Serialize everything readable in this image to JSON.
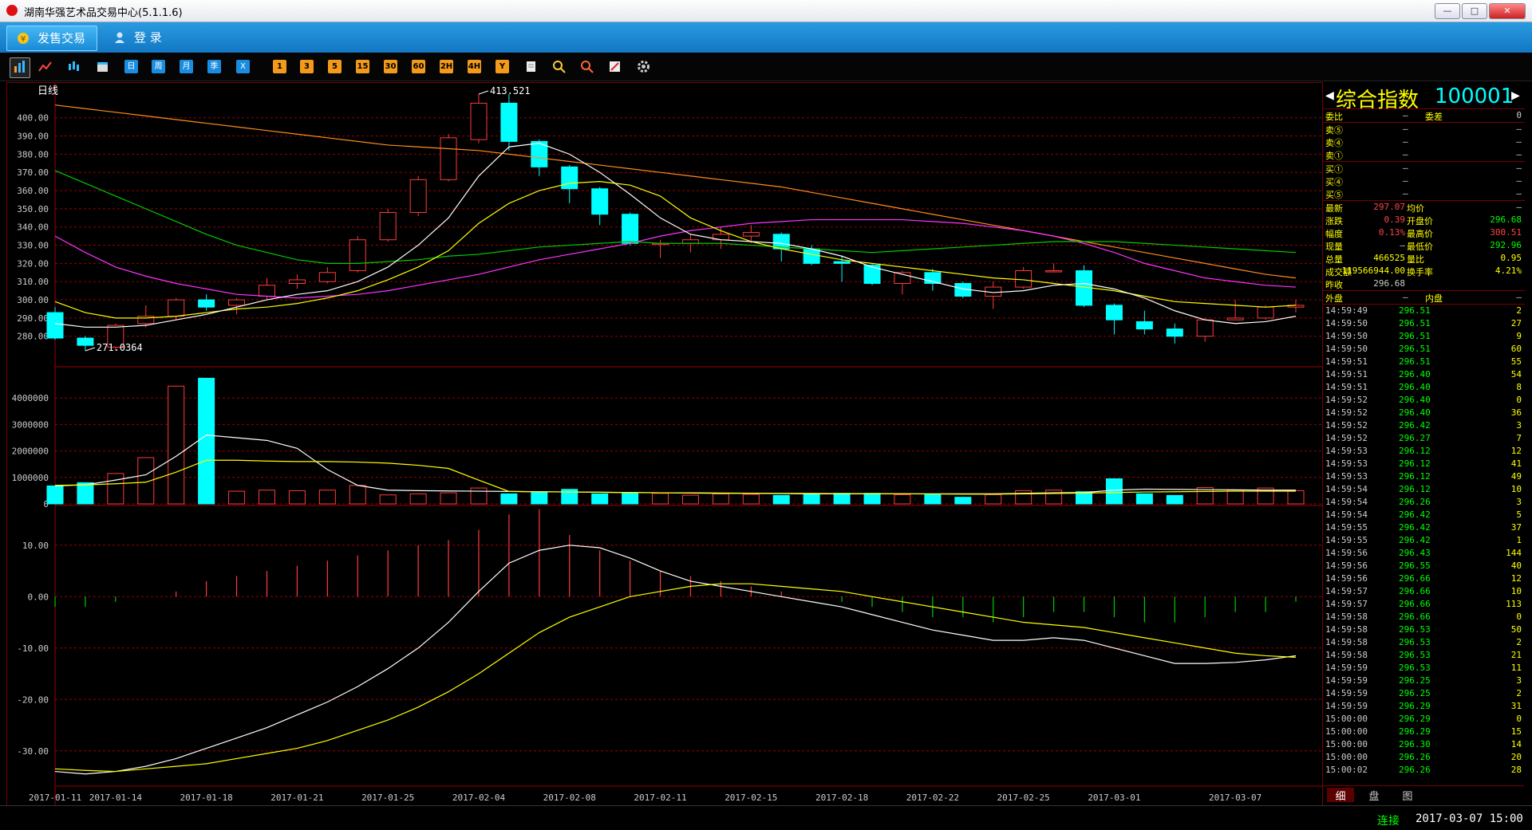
{
  "window": {
    "title": "湖南华强艺术品交易中心(5.1.1.6)",
    "minimize": "—",
    "maximize": "□",
    "close": "✕"
  },
  "menu": {
    "tab_trade": "发售交易",
    "tab_login": "登  录"
  },
  "toolbar": {
    "buttons_a": [
      "日",
      "周",
      "月",
      "季",
      "X"
    ],
    "buttons_b": [
      "1",
      "3",
      "5",
      "15",
      "30",
      "60",
      "2H",
      "4H",
      "Y"
    ]
  },
  "chart_period": "日线",
  "quote": {
    "name": "综合指数",
    "code": "100001",
    "rows1": [
      {
        "l": "委比",
        "v": "—",
        "l2": "委差",
        "v2": "0"
      }
    ],
    "sell": [
      {
        "l": "卖⑤",
        "v": "—",
        "v2": "—"
      },
      {
        "l": "卖④",
        "v": "—",
        "v2": "—"
      },
      {
        "l": "卖①",
        "v": "—",
        "v2": "—"
      }
    ],
    "buy": [
      {
        "l": "买①",
        "v": "—",
        "v2": "—"
      },
      {
        "l": "买④",
        "v": "—",
        "v2": "—"
      },
      {
        "l": "买⑤",
        "v": "—",
        "v2": "—"
      }
    ],
    "stats": [
      {
        "l": "最新",
        "v": "297.07",
        "l2": "均价",
        "v2": "—",
        "c": "#f44",
        "c2": "#ccc"
      },
      {
        "l": "涨跌",
        "v": "0.39",
        "l2": "开盘价",
        "v2": "296.68",
        "c": "#f44",
        "c2": "#0f0"
      },
      {
        "l": "幅度",
        "v": "0.13%",
        "l2": "最高价",
        "v2": "300.51",
        "c": "#f44",
        "c2": "#f44"
      },
      {
        "l": "现量",
        "v": "—",
        "l2": "最低价",
        "v2": "292.96",
        "c": "#ccc",
        "c2": "#0f0"
      },
      {
        "l": "总量",
        "v": "466525",
        "l2": "量比",
        "v2": "0.95",
        "c": "#ff0",
        "c2": "#ff0"
      },
      {
        "l": "成交额",
        "v": "119566944.00",
        "l2": "换手率",
        "v2": "4.21%",
        "c": "#ff0",
        "c2": "#ff0"
      },
      {
        "l": "昨收",
        "v": "296.68",
        "l2": "",
        "v2": "",
        "c": "#ccc",
        "c2": "#ccc"
      }
    ],
    "outer_label": "外盘",
    "outer_val": "—",
    "inner_label": "内盘",
    "inner_val": "—"
  },
  "ticks": [
    [
      "14:59:49",
      "296.51",
      "2"
    ],
    [
      "14:59:50",
      "296.51",
      "27"
    ],
    [
      "14:59:50",
      "296.51",
      "9"
    ],
    [
      "14:59:50",
      "296.51",
      "60"
    ],
    [
      "14:59:51",
      "296.51",
      "55"
    ],
    [
      "14:59:51",
      "296.40",
      "54"
    ],
    [
      "14:59:51",
      "296.40",
      "8"
    ],
    [
      "14:59:52",
      "296.40",
      "0"
    ],
    [
      "14:59:52",
      "296.40",
      "36"
    ],
    [
      "14:59:52",
      "296.42",
      "3"
    ],
    [
      "14:59:52",
      "296.27",
      "7"
    ],
    [
      "14:59:53",
      "296.12",
      "12"
    ],
    [
      "14:59:53",
      "296.12",
      "41"
    ],
    [
      "14:59:53",
      "296.12",
      "49"
    ],
    [
      "14:59:54",
      "296.12",
      "10"
    ],
    [
      "14:59:54",
      "296.26",
      "3"
    ],
    [
      "14:59:54",
      "296.42",
      "5"
    ],
    [
      "14:59:55",
      "296.42",
      "37"
    ],
    [
      "14:59:55",
      "296.42",
      "1"
    ],
    [
      "14:59:56",
      "296.43",
      "144"
    ],
    [
      "14:59:56",
      "296.55",
      "40"
    ],
    [
      "14:59:56",
      "296.66",
      "12"
    ],
    [
      "14:59:57",
      "296.66",
      "10"
    ],
    [
      "14:59:57",
      "296.66",
      "113"
    ],
    [
      "14:59:58",
      "296.66",
      "0"
    ],
    [
      "14:59:58",
      "296.53",
      "50"
    ],
    [
      "14:59:58",
      "296.53",
      "2"
    ],
    [
      "14:59:58",
      "296.53",
      "21"
    ],
    [
      "14:59:59",
      "296.53",
      "11"
    ],
    [
      "14:59:59",
      "296.25",
      "3"
    ],
    [
      "14:59:59",
      "296.25",
      "2"
    ],
    [
      "14:59:59",
      "296.29",
      "31"
    ],
    [
      "15:00:00",
      "296.29",
      "0"
    ],
    [
      "15:00:00",
      "296.29",
      "15"
    ],
    [
      "15:00:00",
      "296.30",
      "14"
    ],
    [
      "15:00:00",
      "296.26",
      "20"
    ],
    [
      "15:00:02",
      "296.26",
      "28"
    ]
  ],
  "bottom_tabs": [
    "细",
    "盘",
    "图"
  ],
  "status": {
    "connection": "连接",
    "datetime": "2017-03-07 15:00"
  },
  "chart_data": {
    "type": "candlestick",
    "price_axis": {
      "ticks": [
        "400.00",
        "390.00",
        "380.00",
        "370.00",
        "360.00",
        "350.00",
        "340.00",
        "330.00",
        "320.00",
        "310.00",
        "300.00",
        "290.00",
        "280.00"
      ],
      "ylim": [
        272,
        413
      ]
    },
    "volume_axis": {
      "ticks": [
        "4000000",
        "3000000",
        "2000000",
        "1000000",
        "0"
      ],
      "ylim": [
        0,
        4700000
      ]
    },
    "macd_axis": {
      "ticks": [
        "10.00",
        "0.00",
        "-10.00",
        "-20.00",
        "-30.00"
      ],
      "ylim": [
        -35,
        14
      ]
    },
    "high_label": "413.521",
    "low_label": "271.0364",
    "x_labels": [
      "2017-01-11",
      "2017-01-14",
      "2017-01-18",
      "2017-01-21",
      "2017-01-25",
      "2017-02-04",
      "2017-02-08",
      "2017-02-11",
      "2017-02-15",
      "2017-02-18",
      "2017-02-22",
      "2017-02-25",
      "2017-03-01",
      "2017-03-07"
    ],
    "x_label_idx": [
      0,
      2,
      5,
      8,
      11,
      14,
      17,
      20,
      23,
      26,
      29,
      32,
      35,
      39
    ],
    "candles": [
      {
        "o": 293,
        "h": 296,
        "l": 278,
        "c": 279
      },
      {
        "o": 279,
        "h": 280,
        "l": 272,
        "c": 275
      },
      {
        "o": 274,
        "h": 287,
        "l": 272,
        "c": 286
      },
      {
        "o": 287,
        "h": 297,
        "l": 285,
        "c": 291
      },
      {
        "o": 291,
        "h": 301,
        "l": 289,
        "c": 300
      },
      {
        "o": 300,
        "h": 303,
        "l": 294,
        "c": 296
      },
      {
        "o": 297,
        "h": 301,
        "l": 292,
        "c": 300
      },
      {
        "o": 302,
        "h": 312,
        "l": 300,
        "c": 308
      },
      {
        "o": 309,
        "h": 314,
        "l": 306,
        "c": 311
      },
      {
        "o": 310,
        "h": 318,
        "l": 309,
        "c": 315
      },
      {
        "o": 316,
        "h": 335,
        "l": 315,
        "c": 333
      },
      {
        "o": 333,
        "h": 350,
        "l": 332,
        "c": 348
      },
      {
        "o": 348,
        "h": 368,
        "l": 346,
        "c": 366
      },
      {
        "o": 366,
        "h": 391,
        "l": 365,
        "c": 389
      },
      {
        "o": 388,
        "h": 413,
        "l": 386,
        "c": 408
      },
      {
        "o": 408,
        "h": 413,
        "l": 382,
        "c": 387
      },
      {
        "o": 387,
        "h": 388,
        "l": 368,
        "c": 373
      },
      {
        "o": 373,
        "h": 374,
        "l": 353,
        "c": 361
      },
      {
        "o": 361,
        "h": 362,
        "l": 341,
        "c": 347
      },
      {
        "o": 347,
        "h": 348,
        "l": 330,
        "c": 331
      },
      {
        "o": 331,
        "h": 333,
        "l": 323,
        "c": 331
      },
      {
        "o": 331,
        "h": 336,
        "l": 326,
        "c": 333
      },
      {
        "o": 333,
        "h": 340,
        "l": 328,
        "c": 336
      },
      {
        "o": 335,
        "h": 341,
        "l": 331,
        "c": 337
      },
      {
        "o": 336,
        "h": 337,
        "l": 321,
        "c": 328
      },
      {
        "o": 328,
        "h": 330,
        "l": 319,
        "c": 320
      },
      {
        "o": 321,
        "h": 324,
        "l": 310,
        "c": 320
      },
      {
        "o": 319,
        "h": 320,
        "l": 308,
        "c": 309
      },
      {
        "o": 309,
        "h": 316,
        "l": 303,
        "c": 315
      },
      {
        "o": 315,
        "h": 317,
        "l": 305,
        "c": 309
      },
      {
        "o": 309,
        "h": 310,
        "l": 301,
        "c": 302
      },
      {
        "o": 302,
        "h": 310,
        "l": 295,
        "c": 307
      },
      {
        "o": 307,
        "h": 318,
        "l": 306,
        "c": 316
      },
      {
        "o": 316,
        "h": 320,
        "l": 315,
        "c": 316
      },
      {
        "o": 316,
        "h": 319,
        "l": 296,
        "c": 297
      },
      {
        "o": 297,
        "h": 298,
        "l": 281,
        "c": 289
      },
      {
        "o": 288,
        "h": 294,
        "l": 281,
        "c": 284
      },
      {
        "o": 284,
        "h": 287,
        "l": 276,
        "c": 280
      },
      {
        "o": 280,
        "h": 290,
        "l": 277,
        "c": 289
      },
      {
        "o": 289,
        "h": 300,
        "l": 289,
        "c": 290
      },
      {
        "o": 290,
        "h": 297,
        "l": 289,
        "c": 296
      },
      {
        "o": 296,
        "h": 300,
        "l": 293,
        "c": 297
      }
    ],
    "volume": [
      680000,
      800000,
      1150000,
      1750000,
      4450000,
      4750000,
      480000,
      520000,
      500000,
      520000,
      700000,
      340000,
      380000,
      420000,
      600000,
      380000,
      430000,
      550000,
      380000,
      410000,
      400000,
      330000,
      380000,
      360000,
      320000,
      380000,
      400000,
      400000,
      350000,
      360000,
      250000,
      350000,
      500000,
      520000,
      460000,
      950000,
      380000,
      320000,
      620000,
      520000,
      600000,
      500000
    ],
    "macd_hist": [
      -2,
      -2,
      -1,
      0,
      1,
      3,
      4,
      5,
      6,
      7,
      8,
      9,
      10,
      11,
      13,
      16,
      17,
      12,
      9,
      7,
      5,
      4,
      3,
      2,
      1,
      0,
      -1,
      -2,
      -3,
      -4,
      -4,
      -5,
      -4,
      -3,
      -3,
      -4,
      -5,
      -5,
      -4,
      -3,
      -3,
      -1
    ],
    "ma5": [
      287,
      285,
      285,
      286,
      289,
      292,
      296,
      300,
      303,
      305,
      310,
      318,
      330,
      345,
      368,
      384,
      386,
      380,
      370,
      358,
      345,
      336,
      333,
      332,
      331,
      328,
      324,
      318,
      314,
      310,
      306,
      304,
      305,
      308,
      309,
      306,
      301,
      294,
      289,
      287,
      288,
      291
    ],
    "ma10": [
      299,
      293,
      290,
      290,
      291,
      293,
      295,
      296,
      298,
      301,
      305,
      311,
      318,
      327,
      342,
      353,
      360,
      364,
      365,
      363,
      357,
      345,
      338,
      332,
      328,
      325,
      322,
      320,
      318,
      316,
      314,
      312,
      311,
      309,
      307,
      305,
      302,
      299,
      298,
      297,
      296,
      297
    ],
    "ma20": [
      371,
      364,
      357,
      350,
      343,
      336,
      330,
      326,
      322,
      320,
      320,
      321,
      322,
      324,
      325,
      327,
      329,
      330,
      331,
      332,
      331,
      331,
      331,
      330,
      329,
      328,
      327,
      326,
      327,
      328,
      329,
      330,
      331,
      332,
      332,
      332,
      331,
      330,
      329,
      328,
      327,
      326
    ],
    "ma30": [
      335,
      326,
      318,
      313,
      309,
      306,
      303,
      302,
      301,
      302,
      303,
      305,
      308,
      311,
      314,
      318,
      322,
      325,
      328,
      331,
      335,
      338,
      340,
      342,
      343,
      344,
      344,
      344,
      344,
      343,
      342,
      340,
      338,
      335,
      331,
      326,
      320,
      316,
      312,
      310,
      308,
      307
    ],
    "ma60": [
      407,
      405,
      403,
      401,
      399,
      397,
      395,
      393,
      391,
      389,
      387,
      385,
      384,
      383,
      382,
      380,
      378,
      376,
      374,
      372,
      370,
      368,
      366,
      364,
      362,
      359,
      356,
      353,
      350,
      347,
      344,
      341,
      338,
      335,
      332,
      329,
      326,
      323,
      320,
      317,
      314,
      312
    ],
    "vol_ma1": [
      680000,
      720000,
      900000,
      1100000,
      1800000,
      2600000,
      2500000,
      2400000,
      2100000,
      1300000,
      700000,
      520000,
      500000,
      490000,
      480000,
      470000,
      460000,
      450000,
      440000,
      430000,
      420000,
      410000,
      400000,
      400000,
      390000,
      380000,
      380000,
      380000,
      380000,
      380000,
      380000,
      380000,
      400000,
      420000,
      430000,
      520000,
      560000,
      550000,
      540000,
      530000,
      520000,
      520000
    ],
    "vol_ma2": [
      700000,
      720000,
      760000,
      820000,
      1200000,
      1650000,
      1650000,
      1620000,
      1600000,
      1600000,
      1580000,
      1540000,
      1460000,
      1340000,
      900000,
      470000,
      460000,
      450000,
      440000,
      430000,
      420000,
      420000,
      410000,
      405000,
      400000,
      395000,
      390000,
      385000,
      380000,
      375000,
      370000,
      370000,
      380000,
      395000,
      410000,
      430000,
      450000,
      460000,
      470000,
      480000,
      480000,
      480000
    ],
    "dif": [
      -34,
      -34.5,
      -34,
      -33,
      -31.5,
      -29.5,
      -27.5,
      -25.5,
      -23,
      -20.5,
      -17.5,
      -14,
      -10,
      -5,
      1,
      6.5,
      9,
      10,
      9.5,
      7.5,
      5,
      3,
      2,
      1,
      0,
      -1,
      -2,
      -3.5,
      -5,
      -6.5,
      -7.5,
      -8.5,
      -8.5,
      -8,
      -8.5,
      -10,
      -11.5,
      -13,
      -13,
      -12.8,
      -12.3,
      -11.5
    ],
    "dea": [
      -33.5,
      -33.8,
      -34,
      -33.5,
      -33,
      -32.5,
      -31.5,
      -30.5,
      -29.5,
      -28,
      -26,
      -24,
      -21.5,
      -18.5,
      -15,
      -11,
      -7,
      -4,
      -2,
      0,
      1,
      2,
      2.5,
      2.5,
      2,
      1.5,
      1,
      0,
      -1,
      -2,
      -3,
      -4,
      -5,
      -5.5,
      -6,
      -7,
      -8,
      -9,
      -10,
      -11,
      -11.5,
      -11.8
    ]
  }
}
